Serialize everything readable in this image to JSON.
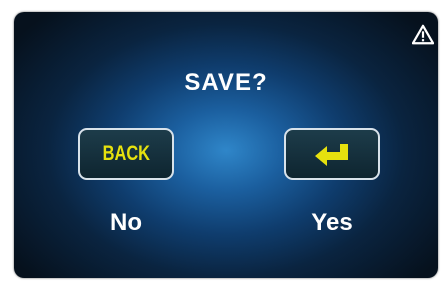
{
  "dialog": {
    "title": "SAVE?",
    "warning_icon": "warning-triangle-icon",
    "back_button": {
      "label": "BACK",
      "label_color": "#e6e10e"
    },
    "enter_button": {
      "icon": "enter-return-icon",
      "icon_color": "#e6e10e"
    },
    "no_label": "No",
    "yes_label": "Yes"
  },
  "colors": {
    "background_center": "#2f86c9",
    "background_edge": "#06111d",
    "button_border": "#d8e2ea",
    "text": "#ffffff"
  }
}
